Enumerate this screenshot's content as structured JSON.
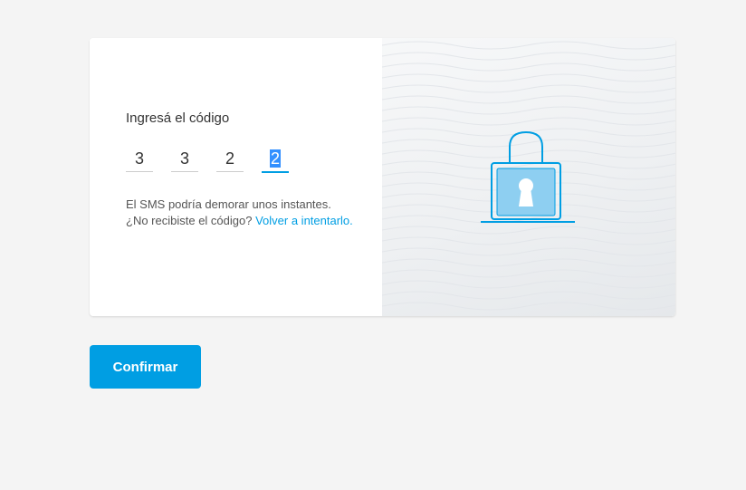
{
  "code_entry": {
    "title": "Ingresá el código",
    "digits": [
      "3",
      "3",
      "2",
      "2"
    ],
    "help_line1": "El SMS podría demorar unos instantes.",
    "help_line2_prefix": "¿No recibiste el código?",
    "retry_link": "Volver a intentarlo."
  },
  "illustration": {
    "icon": "padlock-icon"
  },
  "actions": {
    "confirm_label": "Confirmar"
  },
  "colors": {
    "accent": "#009ee3",
    "lock_fill": "#8ecff1",
    "background": "#f4f4f4"
  }
}
